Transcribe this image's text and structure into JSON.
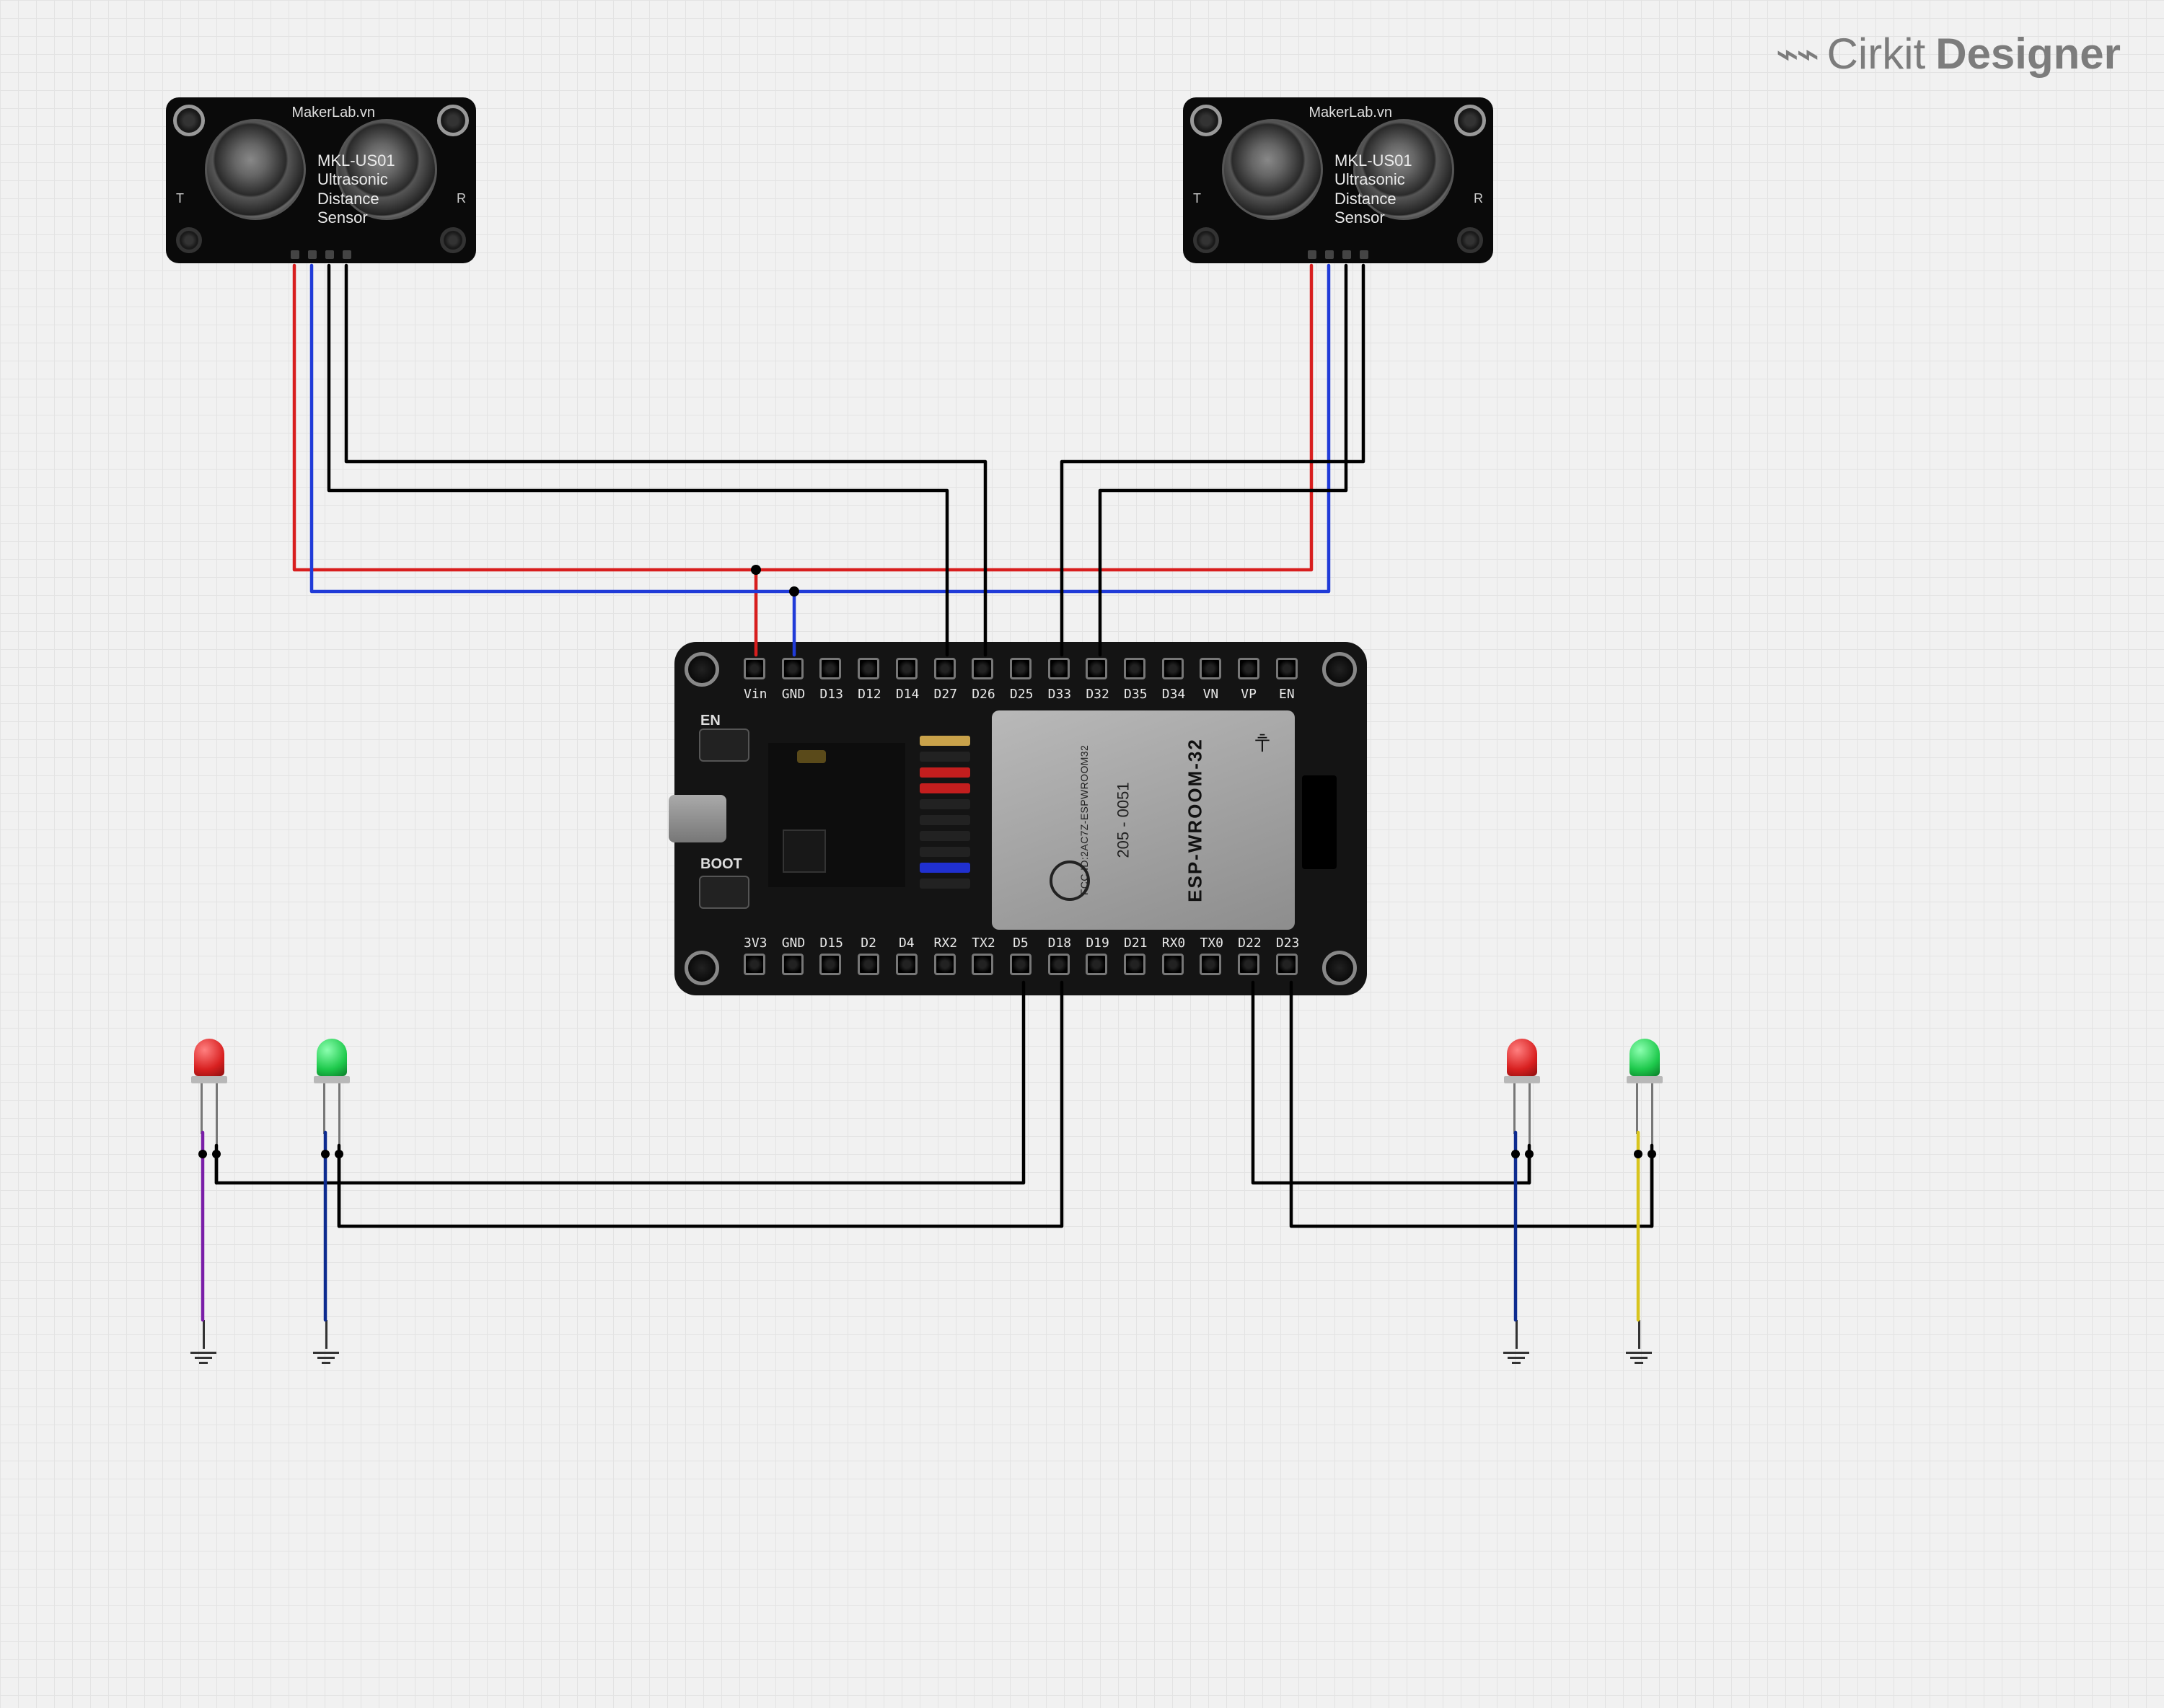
{
  "app": {
    "brand_icon": "⌁⌁",
    "brand1": "Cirkit",
    "brand2": "Designer"
  },
  "components": {
    "ultrasonic_left": {
      "vendor": "MakerLab.vn",
      "model": "MKL-US01",
      "line2": "Ultrasonic",
      "line3": "Distance",
      "line4": "Sensor",
      "pin_t": "T",
      "pin_r": "R"
    },
    "ultrasonic_right": {
      "vendor": "MakerLab.vn",
      "model": "MKL-US01",
      "line2": "Ultrasonic",
      "line3": "Distance",
      "line4": "Sensor",
      "pin_t": "T",
      "pin_r": "R"
    },
    "esp32": {
      "btn_en": "EN",
      "btn_boot": "BOOT",
      "shield_fcc": "FCC ID:2AC7Z-ESPWROOM32",
      "shield_mid": "205 - 0051",
      "shield_name": "ESP-WROOM-32",
      "wifi_label": "WiFi",
      "pins_top": [
        "Vin",
        "GND",
        "D13",
        "D12",
        "D14",
        "D27",
        "D26",
        "D25",
        "D33",
        "D32",
        "D35",
        "D34",
        "VN",
        "VP",
        "EN"
      ],
      "pins_bot": [
        "3V3",
        "GND",
        "D15",
        "D2",
        "D4",
        "RX2",
        "TX2",
        "D5",
        "D18",
        "D19",
        "D21",
        "RX0",
        "TX0",
        "D22",
        "D23"
      ]
    },
    "led1": {
      "color": "red"
    },
    "led2": {
      "color": "green"
    },
    "led3": {
      "color": "red"
    },
    "led4": {
      "color": "green"
    }
  },
  "wiring": {
    "description": "Two ultrasonic sensors share VCC/GND to ESP32 Vin/GND; left sensor Trig/Echo to D26/D27; right sensor Trig/Echo to D33/D32. Four LEDs cathode to GND, anodes to D5/D18 (left pair) and D22/D23 (right pair).",
    "nets": [
      {
        "color": "red",
        "nodes": [
          "ultrasonic_left.VCC",
          "ultrasonic_right.VCC",
          "esp32.Vin"
        ]
      },
      {
        "color": "blue",
        "nodes": [
          "ultrasonic_left.GND",
          "ultrasonic_right.GND",
          "esp32.GND_top"
        ]
      },
      {
        "color": "black",
        "nodes": [
          "ultrasonic_left.TRIG",
          "esp32.D27"
        ]
      },
      {
        "color": "black",
        "nodes": [
          "ultrasonic_left.ECHO",
          "esp32.D26"
        ]
      },
      {
        "color": "black",
        "nodes": [
          "ultrasonic_right.TRIG",
          "esp32.D32"
        ]
      },
      {
        "color": "black",
        "nodes": [
          "ultrasonic_right.ECHO",
          "esp32.D33"
        ]
      },
      {
        "color": "black",
        "nodes": [
          "led1.anode",
          "esp32.D5"
        ]
      },
      {
        "color": "black",
        "nodes": [
          "led2.anode",
          "esp32.D18"
        ]
      },
      {
        "color": "black",
        "nodes": [
          "led3.anode",
          "esp32.D22"
        ]
      },
      {
        "color": "black",
        "nodes": [
          "led4.anode",
          "esp32.D23"
        ]
      },
      {
        "color": "purple",
        "nodes": [
          "led1.cathode",
          "GND"
        ]
      },
      {
        "color": "darkblue",
        "nodes": [
          "led2.cathode",
          "GND"
        ]
      },
      {
        "color": "darkblue",
        "nodes": [
          "led3.cathode",
          "GND"
        ]
      },
      {
        "color": "yellow",
        "nodes": [
          "led4.cathode",
          "GND"
        ]
      }
    ]
  }
}
